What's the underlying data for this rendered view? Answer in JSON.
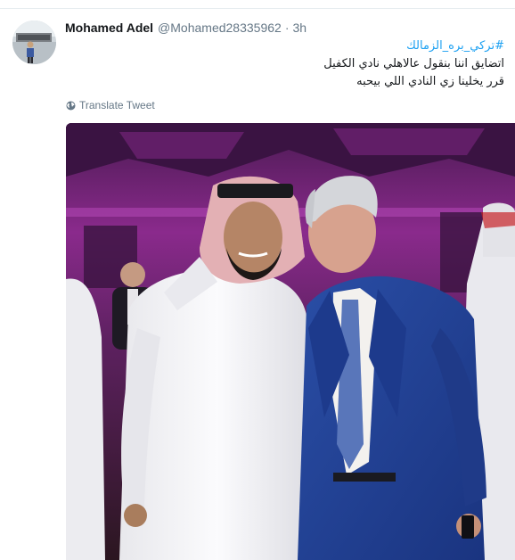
{
  "tweet": {
    "author_name": "Mohamed Adel",
    "author_handle": "@Mohamed28335962",
    "separator": "·",
    "time": "3h",
    "hashtag": "#تركي_بره_الزمالك",
    "line1": "اتضايق اننا بنقول عالاهلي نادي الكفيل",
    "line2": "قرر يخلينا زي النادي اللي بيحبه",
    "translate_label": "Translate Tweet"
  },
  "icons": {
    "avatar": "avatar",
    "translate": "globe-icon",
    "photo": "tweet-photo"
  },
  "colors": {
    "hashtag": "#1da1f2",
    "meta": "#657786",
    "text": "#14171a"
  }
}
